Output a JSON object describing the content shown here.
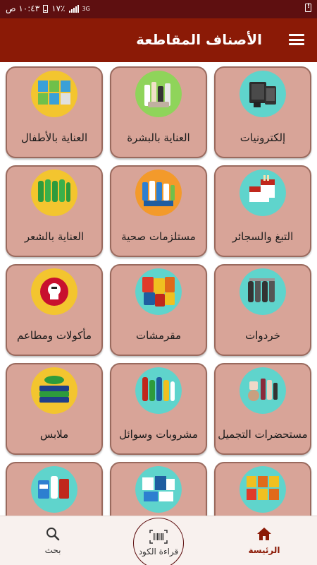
{
  "status_bar": {
    "time": "١٠:٤٣ ص",
    "battery": "١٧٪",
    "network": "3G"
  },
  "app_bar": {
    "title": "الأصناف المقاطعة",
    "menu_icon": "menu-icon"
  },
  "categories": [
    {
      "label": "إلكترونيات",
      "icon": "electronics-image",
      "circle_color": "#5fd4cc"
    },
    {
      "label": "العناية بالبشرة",
      "icon": "skincare-image",
      "circle_color": "#8fd45a"
    },
    {
      "label": "العناية بالأطفال",
      "icon": "baby-care-image",
      "circle_color": "#f3c52f"
    },
    {
      "label": "التبغ والسجائر",
      "icon": "tobacco-image",
      "circle_color": "#5fd4cc"
    },
    {
      "label": "مستلزمات صحية",
      "icon": "health-supplies-image",
      "circle_color": "#f39a2b"
    },
    {
      "label": "العناية بالشعر",
      "icon": "hair-care-image",
      "circle_color": "#f3c52f"
    },
    {
      "label": "خردوات",
      "icon": "hardware-image",
      "circle_color": "#5fd4cc"
    },
    {
      "label": "مقرمشات",
      "icon": "snacks-image",
      "circle_color": "#5fd4cc"
    },
    {
      "label": "مأكولات ومطاعم",
      "icon": "kfc-image",
      "circle_color": "#f3c52f"
    },
    {
      "label": "مستحضرات التجميل",
      "icon": "cosmetics-image",
      "circle_color": "#5fd4cc"
    },
    {
      "label": "مشروبات وسوائل",
      "icon": "drinks-image",
      "circle_color": "#5fd4cc"
    },
    {
      "label": "ملابس",
      "icon": "clothes-image",
      "circle_color": "#f3c52f"
    },
    {
      "label": "",
      "icon": "food-packages-image",
      "circle_color": "#5fd4cc"
    },
    {
      "label": "",
      "icon": "paper-products-image",
      "circle_color": "#5fd4cc"
    },
    {
      "label": "",
      "icon": "detergents-image",
      "circle_color": "#5fd4cc"
    }
  ],
  "bottom_nav": {
    "home": {
      "label": "الرئيسة",
      "icon": "home-icon"
    },
    "scan": {
      "label": "قراءة الكود",
      "icon": "barcode-scan-icon"
    },
    "search": {
      "label": "بحث",
      "icon": "search-icon"
    }
  },
  "colors": {
    "status_bar": "#5e0f10",
    "app_bar": "#8b1a06",
    "card": "#d8a498",
    "accent": "#8b1a06"
  }
}
